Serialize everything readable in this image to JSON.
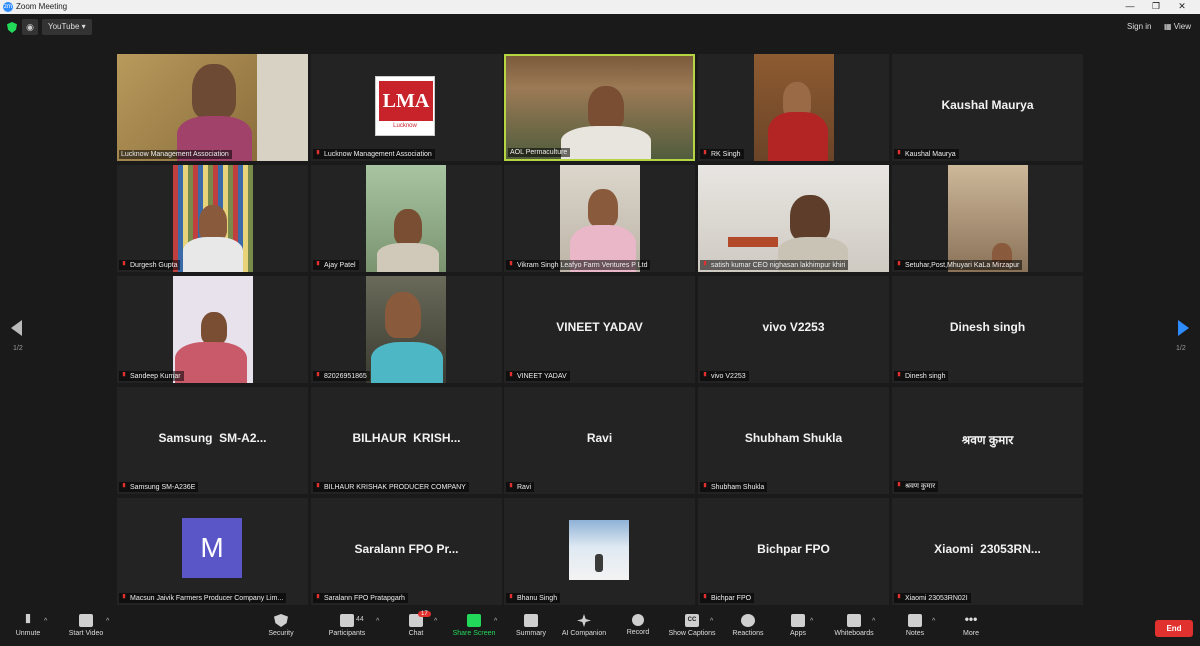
{
  "window": {
    "title": "Zoom Meeting",
    "logo_text": "zm",
    "controls": [
      "—",
      "❐",
      "✕"
    ]
  },
  "topbar": {
    "youtube_label": "YouTube ▾",
    "sign_in": "Sign in",
    "view": "▦ View",
    "rss_glyph": "◉"
  },
  "pagination": {
    "left": "1/2",
    "right": "1/2"
  },
  "tiles": [
    {
      "label": "Lucknow Management Association",
      "muted": false,
      "kind": "video"
    },
    {
      "label": "Lucknow Management Association",
      "muted": true,
      "kind": "logo",
      "logo_text": "LMA",
      "logo_sub": "Lucknow"
    },
    {
      "label": "AOL Permaculture",
      "muted": false,
      "kind": "video",
      "active": true
    },
    {
      "label": "RK Singh",
      "muted": true,
      "kind": "video"
    },
    {
      "label": "Kaushal Maurya",
      "muted": true,
      "kind": "name",
      "bigname": "Kaushal Maurya"
    },
    {
      "label": "Durgesh Gupta",
      "muted": true,
      "kind": "video"
    },
    {
      "label": "Ajay Patel",
      "muted": true,
      "kind": "video"
    },
    {
      "label": "Vikram Singh Leafyo Farm Ventures P Ltd",
      "muted": true,
      "kind": "video"
    },
    {
      "label": "satish kumar CEO nighasan lakhimpur khiri",
      "muted": true,
      "kind": "video"
    },
    {
      "label": "Setuhar,Post,Mhuyari KaLa Mirzapur",
      "muted": true,
      "kind": "video"
    },
    {
      "label": "Sandeep Kumar",
      "muted": true,
      "kind": "video"
    },
    {
      "label": "8202695186​5",
      "muted": true,
      "kind": "video"
    },
    {
      "label": "VINEET YADAV",
      "muted": true,
      "kind": "name",
      "bigname": "VINEET YADAV"
    },
    {
      "label": "vivo V2253",
      "muted": true,
      "kind": "name",
      "bigname": "vivo V2253"
    },
    {
      "label": "Dinesh singh",
      "muted": true,
      "kind": "name",
      "bigname": "Dinesh singh"
    },
    {
      "label": "Samsung SM-A236E",
      "muted": true,
      "kind": "name",
      "bigname": "Samsung  SM-A2..."
    },
    {
      "label": "BILHAUR KRISHAK PRODUCER COMPANY",
      "muted": true,
      "kind": "name",
      "bigname": "BILHAUR  KRISH..."
    },
    {
      "label": "Ravi",
      "muted": true,
      "kind": "name",
      "bigname": "Ravi"
    },
    {
      "label": "Shubham Shukla",
      "muted": true,
      "kind": "name",
      "bigname": "Shubham Shukla"
    },
    {
      "label": "श्रवण कुमार",
      "muted": true,
      "kind": "name",
      "bigname": "श्रवण कुमार"
    },
    {
      "label": "Macsun Jaivik Farmers Producer Company Lim...",
      "muted": true,
      "kind": "avatar",
      "avatar_letter": "M"
    },
    {
      "label": "Saralann FPO Pratapgarh",
      "muted": true,
      "kind": "name",
      "bigname": "Saralann FPO Pr..."
    },
    {
      "label": "Bhanu Singh",
      "muted": true,
      "kind": "video"
    },
    {
      "label": "Bichpar FPO",
      "muted": true,
      "kind": "name",
      "bigname": "Bichpar FPO"
    },
    {
      "label": "Xiaomi 23053RN02I",
      "muted": true,
      "kind": "name",
      "bigname": "Xiaomi  23053RN..."
    }
  ],
  "toolbar": {
    "unmute": "Unmute",
    "start_video": "Start Video",
    "security": "Security",
    "participants": "Participants",
    "participants_count": "44",
    "chat": "Chat",
    "chat_badge": "17",
    "share_screen": "Share Screen",
    "summary": "Summary",
    "ai_companion": "AI Companion",
    "record": "Record",
    "show_captions": "Show Captions",
    "reactions": "Reactions",
    "apps": "Apps",
    "whiteboards": "Whiteboards",
    "notes": "Notes",
    "more": "More",
    "end": "End",
    "caret": "^",
    "cc_text": "CC"
  },
  "colors": {
    "active_border": "#b5d642",
    "end": "#e0312f",
    "share": "#23d959",
    "accent": "#2d8cff"
  }
}
